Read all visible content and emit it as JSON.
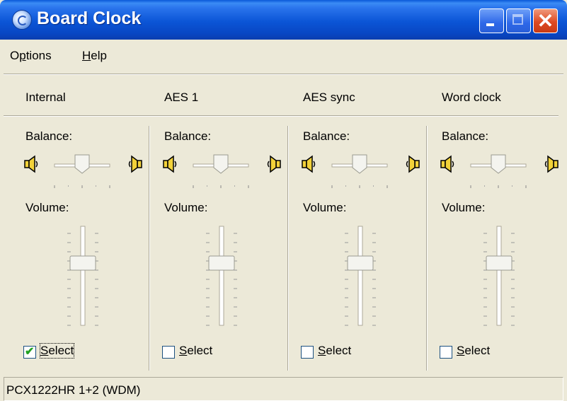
{
  "window": {
    "title": "Board Clock",
    "colors": {
      "titlebar": "#0b55d6",
      "face": "#ece9d8",
      "check": "#21a121"
    }
  },
  "menu": [
    {
      "label_pre": "O",
      "label_u": "p",
      "label_post": "tions"
    },
    {
      "label_pre": "",
      "label_u": "H",
      "label_post": "elp"
    }
  ],
  "channels": [
    {
      "name": "Internal",
      "balance_label": "Balance:",
      "volume_label": "Volume:",
      "balance_value": 0.5,
      "volume_value": 0.3,
      "select_label": "Select",
      "select_underline": "S",
      "select_rest": "elect",
      "checked": true
    },
    {
      "name": "AES 1",
      "balance_label": "Balance:",
      "volume_label": "Volume:",
      "balance_value": 0.5,
      "volume_value": 0.3,
      "select_label": "Select",
      "select_underline": "S",
      "select_rest": "elect",
      "checked": false
    },
    {
      "name": "AES sync",
      "balance_label": "Balance:",
      "volume_label": "Volume:",
      "balance_value": 0.5,
      "volume_value": 0.3,
      "select_label": "Select",
      "select_underline": "S",
      "select_rest": "elect",
      "checked": false
    },
    {
      "name": "Word clock",
      "balance_label": "Balance:",
      "volume_label": "Volume:",
      "balance_value": 0.5,
      "volume_value": 0.3,
      "select_label": "Select",
      "select_underline": "S",
      "select_rest": "elect",
      "checked": false
    }
  ],
  "statusbar": {
    "text": "PCX1222HR 1+2 (WDM)"
  },
  "icons": {
    "app": "board-clock-icon",
    "speaker_left": "speaker-left-icon",
    "speaker_right": "speaker-right-icon"
  }
}
